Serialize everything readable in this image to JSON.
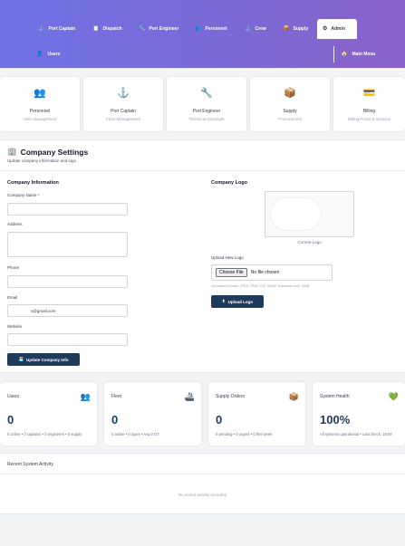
{
  "nav": {
    "tabs": [
      {
        "label": "Port Captain",
        "icon": "anchor-icon",
        "glyph": "⚓"
      },
      {
        "label": "Dispatch",
        "icon": "clipboard-icon",
        "glyph": "📋"
      },
      {
        "label": "Port Engineer",
        "icon": "wrench-icon",
        "glyph": "🔧"
      },
      {
        "label": "Personnel",
        "icon": "people-icon",
        "glyph": "👥"
      },
      {
        "label": "Crew",
        "icon": "anchor-icon",
        "glyph": "⚓"
      },
      {
        "label": "Supply",
        "icon": "package-icon",
        "glyph": "📦"
      },
      {
        "label": "Admin",
        "icon": "gear-icon",
        "glyph": "⚙"
      }
    ],
    "subnav": {
      "users": {
        "label": "Users",
        "glyph": "👤"
      },
      "main_menu": {
        "label": "Main Menu",
        "glyph": "🏠"
      }
    }
  },
  "roles": [
    {
      "name": "Personnel",
      "desc": "User Management",
      "glyph": "👥"
    },
    {
      "name": "Port Captain",
      "desc": "Fleet Management",
      "glyph": "⚓"
    },
    {
      "name": "Port Engineer",
      "desc": "Technical Oversight",
      "glyph": "🔧"
    },
    {
      "name": "Supply",
      "desc": "Procurement",
      "glyph": "📦"
    },
    {
      "name": "Billing",
      "desc": "Billing Portal & Invoices",
      "glyph": "💳"
    }
  ],
  "settings": {
    "title": "Company Settings",
    "title_glyph": "🏢",
    "subtitle": "Update company information and logo",
    "info_heading": "Company Information",
    "fields": {
      "name_label": "Company Name *",
      "name_value": "",
      "address_label": "Address",
      "address_value": "",
      "phone_label": "Phone",
      "phone_value": "",
      "email_label": "Email",
      "email_value": "v@gmail.com",
      "website_label": "Website",
      "website_value": ""
    },
    "update_button": "Update Company Info",
    "update_glyph": "💾",
    "logo_heading": "Company Logo",
    "current_logo_caption": "Current Logo",
    "upload_label": "Upload New Logo",
    "choose_file": "Choose File",
    "no_file": "No file chosen",
    "accepted_formats": "Accepted formats: JPEG, PNG, GIF, WebP. Maximum size: 5MB",
    "upload_button": "Upload Logo",
    "upload_glyph": "⬆"
  },
  "stats": [
    {
      "name": "Users",
      "value": "0",
      "detail": "0 active • 0 captains • 0 engineers • 0 supply",
      "glyph": "👥"
    },
    {
      "name": "Fleet",
      "value": "0",
      "detail": "0 active • 0 types • Avg 0 GT",
      "glyph": "🚢"
    },
    {
      "name": "Supply Orders",
      "value": "0",
      "detail": "0 pending • 0 urgent • 0 this week",
      "glyph": "📦"
    },
    {
      "name": "System Health",
      "value": "100%",
      "detail": "All systems operational • Last check: 19:59",
      "glyph": "💚"
    }
  ],
  "activity": {
    "title": "Recent System Activity",
    "empty": "No recent activity recorded"
  }
}
